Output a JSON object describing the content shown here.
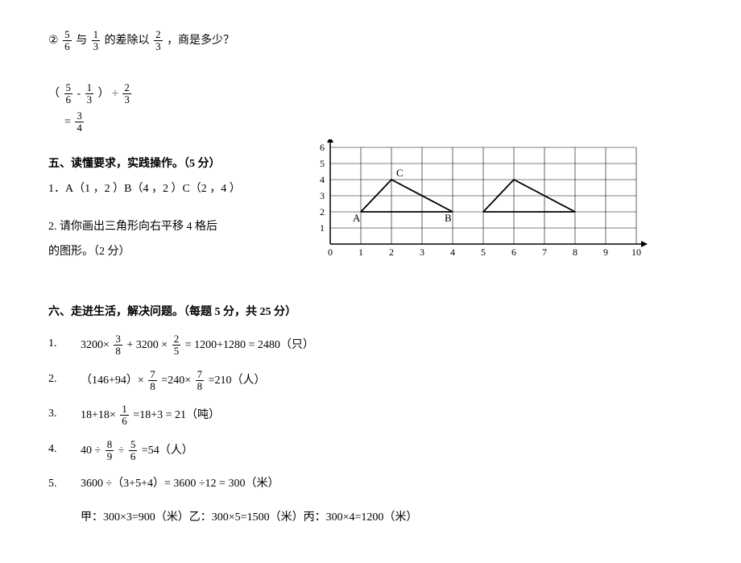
{
  "q2": {
    "circ": "②",
    "text": "的差除以",
    "text2": "，商是多少？",
    "f1n": "5",
    "f1d": "6",
    "yu": "与",
    "f2n": "1",
    "f2d": "3",
    "f3n": "2",
    "f3d": "3",
    "lparen": "（",
    "rparen": "）",
    "minus": "-",
    "div": "÷",
    "eq": "=",
    "ansn": "3",
    "ansd": "4"
  },
  "sec5": {
    "title": "五、读懂要求，实践操作。（5 分）",
    "line1": "1．A（1 ，2 ）B（4 ，2 ）C（2 ，4 ）",
    "line2a": "2. 请你画出三角形向右平移 4 格后",
    "line2b": "的图形。（2 分）"
  },
  "sec6": {
    "title": "六、走进生活，解决问题。（每题 5 分，共 25 分）",
    "q1": {
      "n": "1.",
      "a1": "3200×",
      "f1n": "3",
      "f1d": "8",
      "a2": "+ 3200 ×",
      "f2n": "2",
      "f2d": "5",
      "a3": "= 1200+1280 = 2480（只）"
    },
    "q2": {
      "n": "2.",
      "a1": "（146+94）×",
      "f1n": "7",
      "f1d": "8",
      "a2": "=240×",
      "f2n": "7",
      "f2d": "8",
      "a3": "=210（人）"
    },
    "q3": {
      "n": "3.",
      "a1": "18+18×",
      "f1n": "1",
      "f1d": "6",
      "a2": "  =18+3 = 21（吨）"
    },
    "q4": {
      "n": "4.",
      "a1": "40 ÷",
      "f1n": "8",
      "f1d": "9",
      "a2": "÷",
      "f2n": "5",
      "f2d": "6",
      "a3": "=54（人）"
    },
    "q5": {
      "n": "5.",
      "a1": "3600 ÷（3+5+4）= 3600 ÷12 = 300（米）",
      "a2": "甲：300×3=900（米）乙：300×5=1500（米）丙：300×4=1200（米）"
    }
  },
  "chart_data": {
    "type": "line",
    "xlabel": "",
    "ylabel": "",
    "x_ticks": [
      0,
      1,
      2,
      3,
      4,
      5,
      6,
      7,
      8,
      9,
      10
    ],
    "y_ticks": [
      1,
      2,
      3,
      4,
      5,
      6
    ],
    "xlim": [
      0,
      10
    ],
    "ylim": [
      0,
      6
    ],
    "grid": true,
    "series": [
      {
        "name": "triangle_original",
        "points": [
          [
            1,
            2
          ],
          [
            4,
            2
          ],
          [
            2,
            4
          ],
          [
            1,
            2
          ]
        ]
      },
      {
        "name": "triangle_shifted",
        "points": [
          [
            5,
            2
          ],
          [
            8,
            2
          ],
          [
            6,
            4
          ],
          [
            5,
            2
          ]
        ]
      }
    ],
    "annotations": [
      {
        "label": "A",
        "x": 1,
        "y": 2
      },
      {
        "label": "B",
        "x": 4,
        "y": 2
      },
      {
        "label": "C",
        "x": 2,
        "y": 4
      }
    ]
  }
}
